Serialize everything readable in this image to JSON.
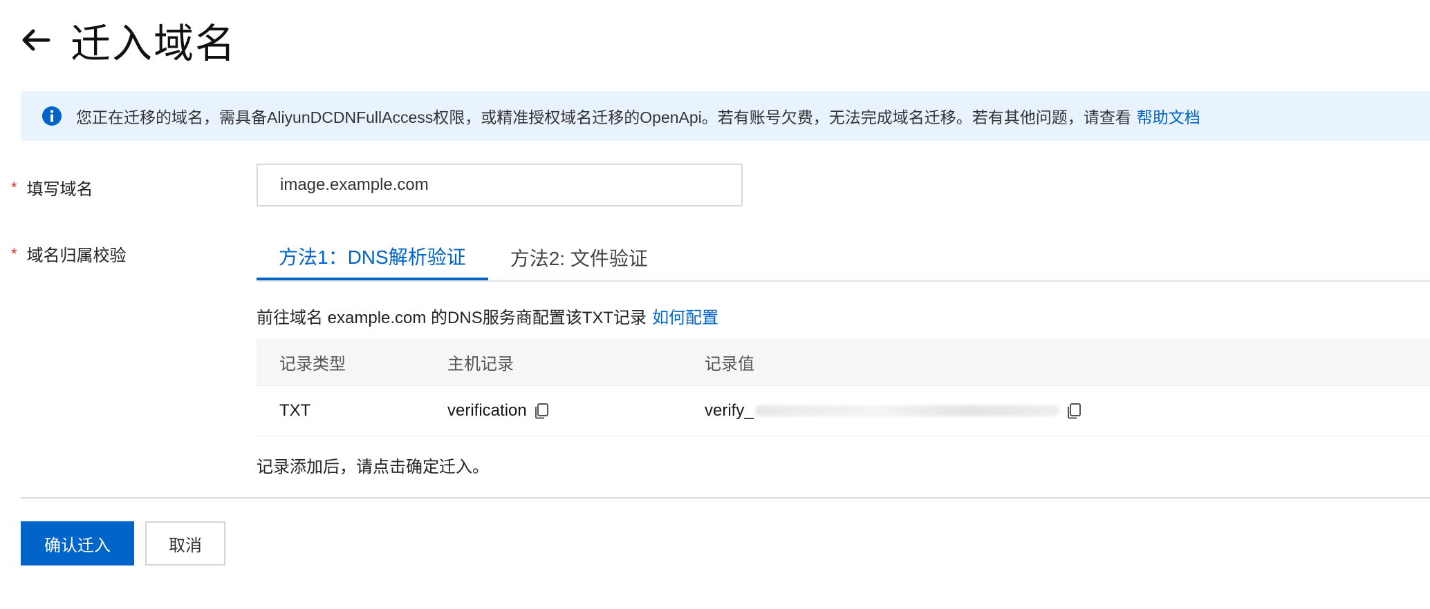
{
  "header": {
    "title": "迁入域名"
  },
  "notice": {
    "text": "您正在迁移的域名，需具备AliyunDCDNFullAccess权限，或精准授权域名迁移的OpenApi。若有账号欠费，无法完成域名迁移。若有其他问题，请查看",
    "link": "帮助文档"
  },
  "form": {
    "required_mark": "*",
    "domain_label": "填写域名",
    "domain_value": "image.example.com",
    "verify_label": "域名归属校验"
  },
  "tabs": [
    {
      "label": "方法1：DNS解析验证",
      "active": true
    },
    {
      "label": "方法2: 文件验证",
      "active": false
    }
  ],
  "instruction": {
    "text": "前往域名 example.com 的DNS服务商配置该TXT记录",
    "link": "如何配置"
  },
  "table": {
    "columns": [
      "记录类型",
      "主机记录",
      "记录值"
    ],
    "rows": [
      {
        "type": "TXT",
        "host": "verification",
        "value": "verify_"
      }
    ]
  },
  "after_note": "记录添加后，请点击确定迁入。",
  "buttons": {
    "confirm": "确认迁入",
    "cancel": "取消"
  },
  "colors": {
    "accent": "#0064c8",
    "notice_bg": "#e8f3fd",
    "required": "#d93026"
  }
}
